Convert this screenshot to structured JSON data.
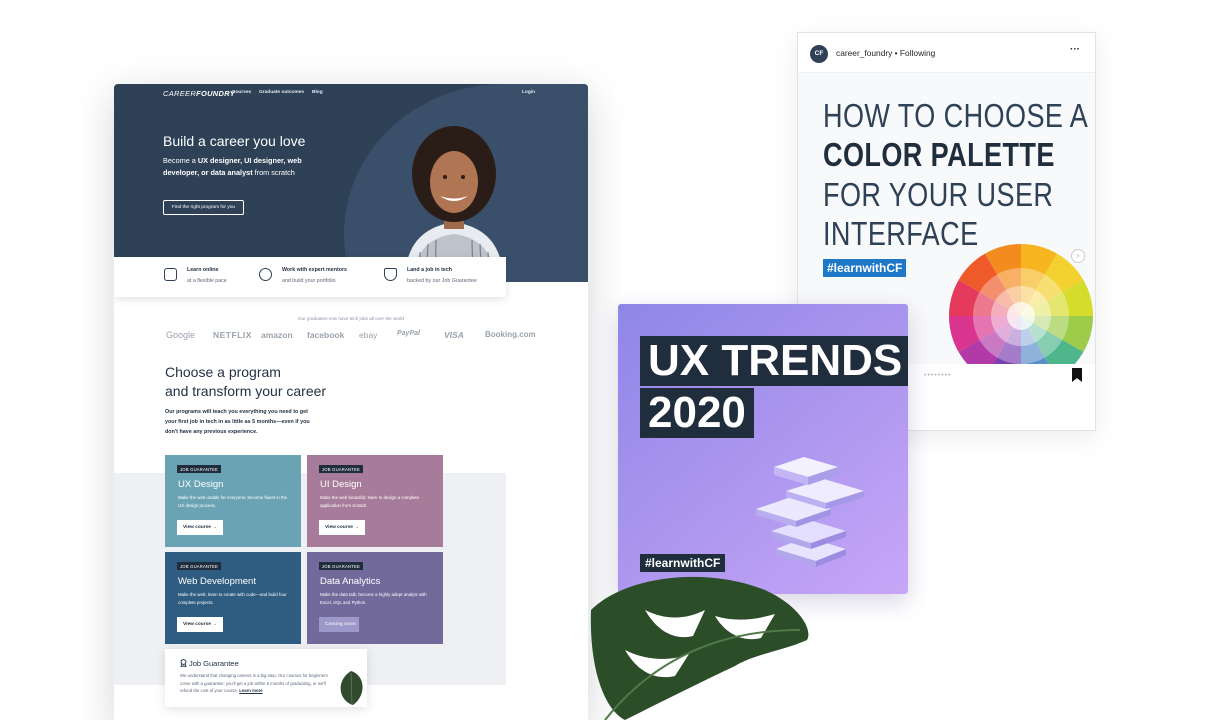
{
  "website": {
    "logo": "CAREERFOUNDRY",
    "logo_a": "CAREER",
    "logo_b": "FOUNDRY",
    "nav": [
      "Courses",
      "Graduate outcomes",
      "Blog"
    ],
    "login": "Login",
    "hero": {
      "title": "Build a career you love",
      "subtitle_pre": "Become a ",
      "subtitle_roles": "UX designer, UI designer, web developer, or data analyst",
      "subtitle_post": " from scratch",
      "cta": "Find the right program for you"
    },
    "features": [
      {
        "title": "Learn online",
        "text": "at a flexible pace",
        "icon": "laptop-icon"
      },
      {
        "title": "Work with expert mentors",
        "text": "and build your portfolio",
        "icon": "mentors-icon"
      },
      {
        "title": "Land a job in tech",
        "text": "backed by our Job Guarantee",
        "icon": "shield-icon"
      }
    ],
    "trust_line": "Our graduates now have tech jobs all over the world",
    "brands": [
      "Google",
      "NETFLIX",
      "amazon",
      "facebook",
      "ebay",
      "PayPal",
      "VISA",
      "Booking.com"
    ],
    "choose_title_1": "Choose a program",
    "choose_title_2": "and transform your career",
    "choose_text": "Our programs will teach you everything you need to get your first job in tech in as little as 5 months—even if you don't have any previous experience.",
    "programs": [
      {
        "badge": "JOB GUARANTEE",
        "title": "UX Design",
        "desc": "Make the web usable for everyone; become fluent in the UX design process.",
        "button": "View course →",
        "color": "#6aa3b4"
      },
      {
        "badge": "JOB GUARANTEE",
        "title": "UI Design",
        "desc": "Make the web beautiful; learn to design a complete application from scratch.",
        "button": "View course →",
        "color": "#a77c9a"
      },
      {
        "badge": "JOB GUARANTEE",
        "title": "Web Development",
        "desc": "Make the web; learn to create with code—and build four complete projects.",
        "button": "View course →",
        "color": "#2f5d82"
      },
      {
        "badge": "JOB GUARANTEE",
        "title": "Data Analytics",
        "desc": "Make the data talk; become a highly adept analyst with Excel, SQL and Python.",
        "button": "Coming soon",
        "color": "#736a9c"
      }
    ],
    "job_guarantee": {
      "title": "Job Guarantee",
      "text": "We understand that changing careers is a big step. Our courses for beginners come with a guarantee: you'll get a job within 6 months of graduating, or we'll refund the cost of your course. ",
      "link": "Learn more"
    }
  },
  "instagram": {
    "avatar": "CF",
    "username": "career_foundry • Following",
    "more": "···",
    "post_lines": [
      "HOW TO CHOOSE A",
      "COLOR PALETTE",
      "FOR YOUR USER",
      "INTERFACE"
    ],
    "hashtag": "#learnwithCF",
    "dots": "••••••••",
    "next": "›"
  },
  "ux_card": {
    "line1": "UX TRENDS",
    "line2": "2020",
    "hashtag": "#learnwithCF"
  }
}
